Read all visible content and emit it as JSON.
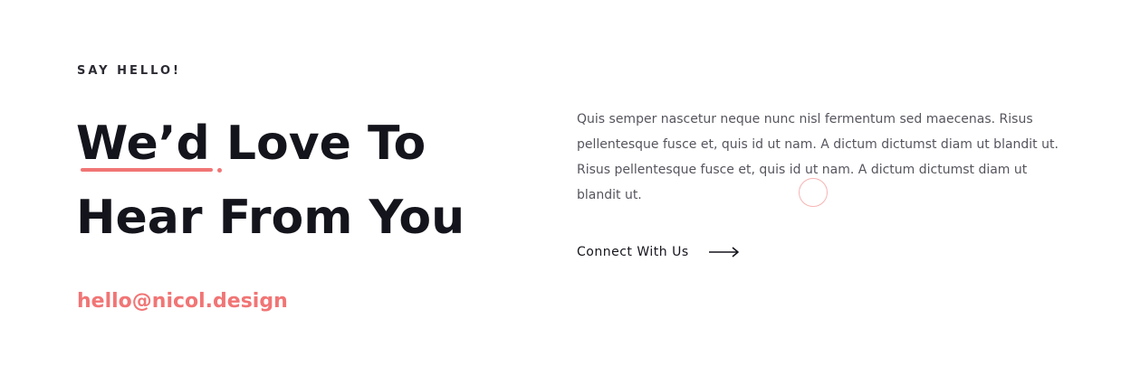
{
  "section": {
    "eyebrow": "SAY HELLO!",
    "headline_line1": "We’d Love To",
    "headline_line2": "Hear From You",
    "email": "hello@nicol.design",
    "description": "Quis semper nascetur neque nunc nisl fermentum sed maecenas. Risus pellentesque fusce et, quis id ut nam. A dictum dictumst diam ut blandit ut. Risus pellentesque fusce et, quis id ut nam. A dictum dictumst diam ut blandit ut.",
    "cta_label": "Connect With Us"
  },
  "icons": {
    "cta_arrow": "arrow-right-icon"
  },
  "colors": {
    "accent": "#f17575",
    "heading": "#14141c",
    "body_text": "#55555e",
    "background": "#ffffff"
  }
}
